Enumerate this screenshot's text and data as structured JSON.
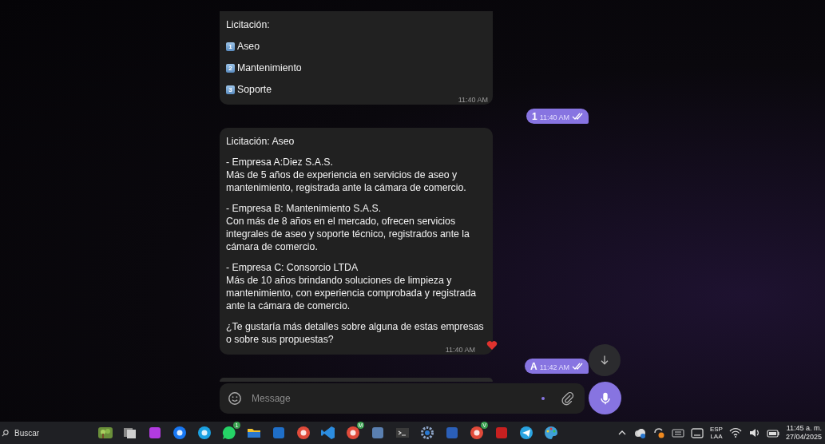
{
  "chat": {
    "messages": [
      {
        "kind": "list",
        "title": "Licitación:",
        "items": [
          {
            "number": "1",
            "label": "Aseo"
          },
          {
            "number": "2",
            "label": "Mantenimiento"
          },
          {
            "number": "3",
            "label": "Soporte"
          }
        ],
        "time": "11:40 AM"
      },
      {
        "kind": "outgoing",
        "text": "1",
        "time": "11:40 AM",
        "read": true
      },
      {
        "kind": "text",
        "paragraphs": [
          "Licitación: Aseo",
          "- Empresa A:Diez S.A.S.\nMás de 5 años de experiencia en servicios de aseo y mantenimiento, registrada ante la cámara de comercio.",
          "- Empresa B: Mantenimiento S.A.S.\nCon más de 8 años en el mercado, ofrecen servicios integrales de aseo y soporte técnico, registrados ante la cámara de comercio.",
          "- Empresa C: Consorcio LTDA\nMás de 10 años brindando soluciones de limpieza y mantenimiento, con experiencia comprobada y registrada ante la cámara de comercio.",
          "¿Te gustaría más detalles sobre alguna de estas empresas o sobre sus propuestas?"
        ],
        "time": "11:40 AM",
        "reaction": true
      },
      {
        "kind": "outgoing",
        "text": "A",
        "time": "11:42 AM",
        "read": true
      },
      {
        "kind": "edge"
      }
    ],
    "composer": {
      "placeholder": "Message"
    }
  },
  "taskbar": {
    "search": {
      "placeholder": "Buscar"
    },
    "apps": [
      {
        "kind": "landscape",
        "color": "#6a8f3a"
      },
      {
        "kind": "squares",
        "color": "#cfcfcf"
      },
      {
        "kind": "square",
        "color": "#b23be0"
      },
      {
        "kind": "circle",
        "color": "#1877f2"
      },
      {
        "kind": "circle",
        "color": "#1ba1e2"
      },
      {
        "kind": "bubble",
        "color": "#25d366",
        "badge": "1"
      },
      {
        "kind": "folder",
        "color": "#f2c230"
      },
      {
        "kind": "square",
        "color": "#1f6fc8"
      },
      {
        "kind": "circle",
        "color": "#e04a3a"
      },
      {
        "kind": "ribbon",
        "color": "#2c8de0"
      },
      {
        "kind": "circle",
        "color": "#e04a3a",
        "badge": "M"
      },
      {
        "kind": "square",
        "color": "#5a7fb0"
      },
      {
        "kind": "terminal",
        "color": "#3a3a3a"
      },
      {
        "kind": "gear",
        "color": "#8fa6c8"
      },
      {
        "kind": "square",
        "color": "#2b5fb8"
      },
      {
        "kind": "circle",
        "color": "#e04a3a",
        "badge": "V"
      },
      {
        "kind": "square",
        "color": "#c82020"
      },
      {
        "kind": "plane",
        "color": "#2aa3e0"
      },
      {
        "kind": "palette",
        "color": "#3fa0d8"
      }
    ],
    "tray": {
      "language": "ESP",
      "layout": "LAA",
      "time": "11:45 a. m.",
      "date": "27/04/2025"
    }
  }
}
